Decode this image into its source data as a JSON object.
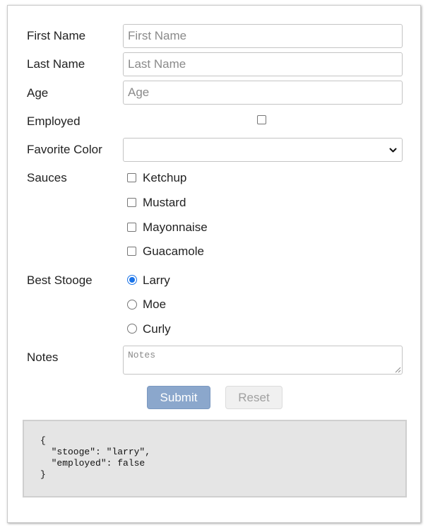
{
  "form": {
    "fields": {
      "first_name": {
        "label": "First Name",
        "placeholder": "First Name",
        "value": ""
      },
      "last_name": {
        "label": "Last Name",
        "placeholder": "Last Name",
        "value": ""
      },
      "age": {
        "label": "Age",
        "placeholder": "Age",
        "value": ""
      },
      "employed": {
        "label": "Employed",
        "checked": false
      },
      "favorite_color": {
        "label": "Favorite Color",
        "selected": ""
      },
      "sauces": {
        "label": "Sauces",
        "options": [
          {
            "label": "Ketchup",
            "checked": false
          },
          {
            "label": "Mustard",
            "checked": false
          },
          {
            "label": "Mayonnaise",
            "checked": false
          },
          {
            "label": "Guacamole",
            "checked": false
          }
        ]
      },
      "best_stooge": {
        "label": "Best Stooge",
        "options": [
          {
            "label": "Larry",
            "selected": true
          },
          {
            "label": "Moe",
            "selected": false
          },
          {
            "label": "Curly",
            "selected": false
          }
        ]
      },
      "notes": {
        "label": "Notes",
        "placeholder": "Notes",
        "value": ""
      }
    },
    "buttons": {
      "submit_label": "Submit",
      "reset_label": "Reset"
    }
  },
  "output": {
    "json_text": "{\n  \"stooge\": \"larry\",\n  \"employed\": false\n}"
  },
  "colors": {
    "accent": "#1a73e8",
    "submit_bg": "#8ba7cc",
    "output_bg": "#e5e5e5"
  }
}
